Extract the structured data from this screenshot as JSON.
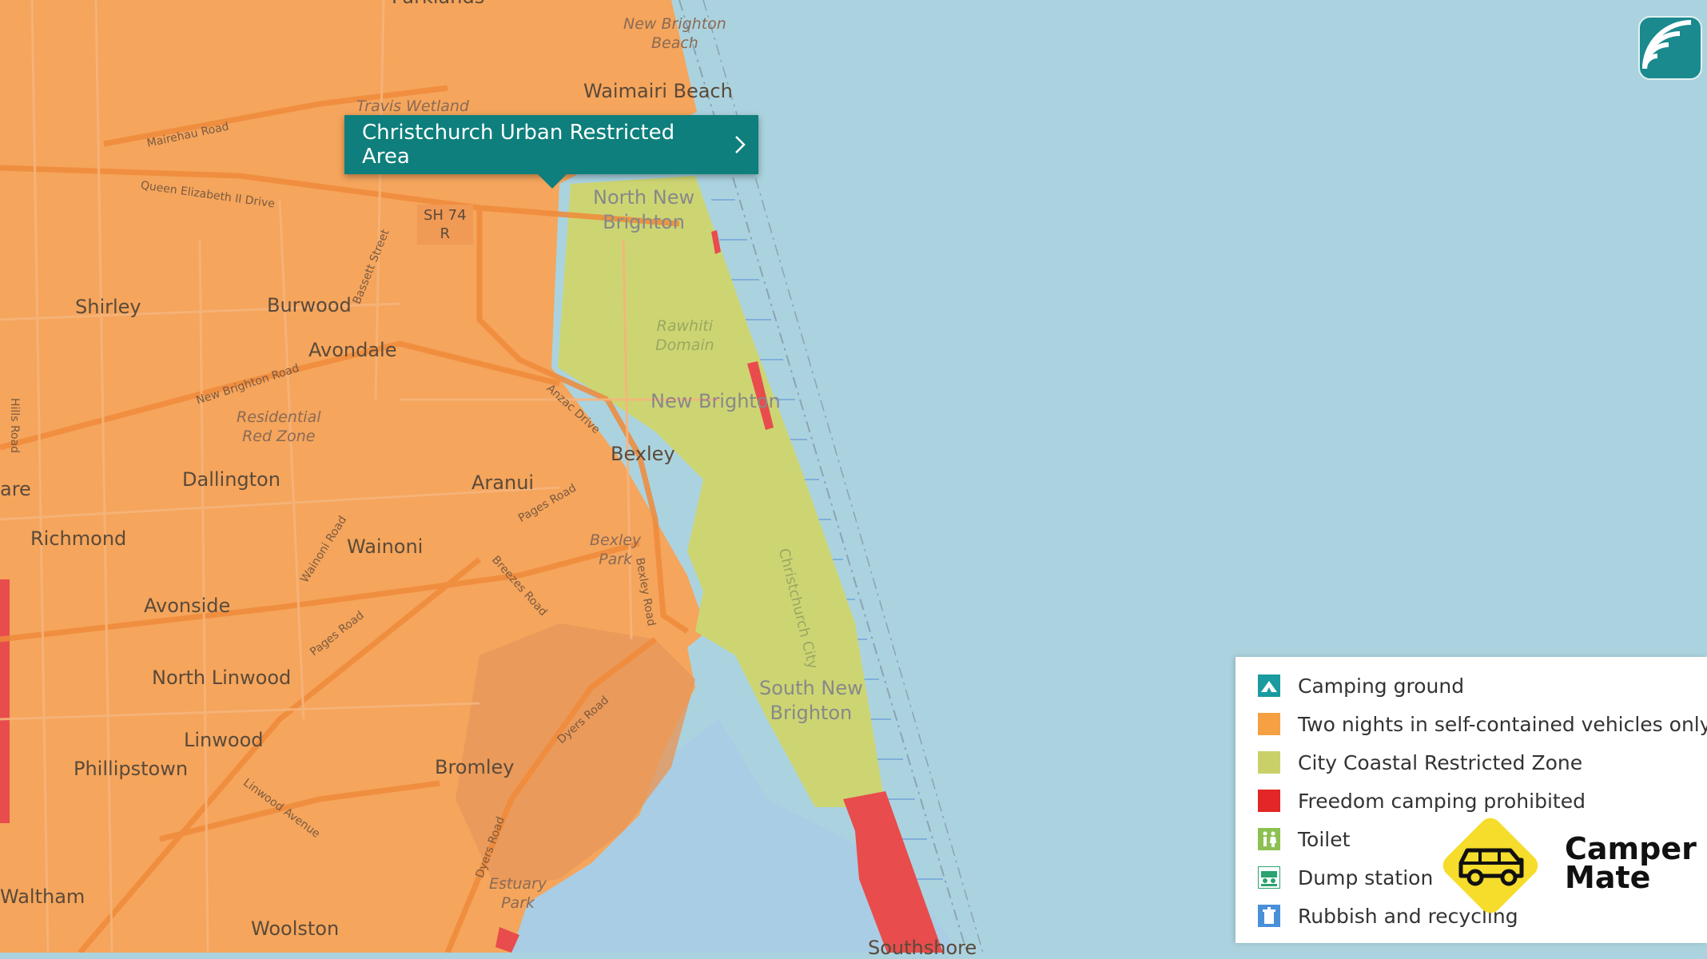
{
  "map": {
    "colors": {
      "water": "#abd3df",
      "two_nights_zone": "#f5a55c",
      "coastal_zone": "#cdd573",
      "prohibited": "#e84c4c",
      "tooltip_bg": "#0e7f7c"
    }
  },
  "places": {
    "parklands": "Parklands",
    "new_brighton_beach": "New Brighton\nBeach",
    "waimairi_beach": "Waimairi Beach",
    "travis_wetland": "Travis Wetland",
    "north_new_brighton": "North New\nBrighton",
    "sh74": "SH 74\nR",
    "shirley": "Shirley",
    "burwood": "Burwood",
    "avondale": "Avondale",
    "rawhiti_domain": "Rawhiti\nDomain",
    "new_brighton": "New Brighton",
    "residential_red_zone": "Residential\nRed Zone",
    "bexley": "Bexley",
    "dallington": "Dallington",
    "aranui": "Aranui",
    "richmond": "Richmond",
    "wainoni": "Wainoni",
    "bexley_park": "Bexley\nPark",
    "avonside": "Avonside",
    "north_linwood": "North Linwood",
    "south_new_brighton": "South New\nBrighton",
    "linwood": "Linwood",
    "phillipstown": "Phillipstown",
    "bromley": "Bromley",
    "estuary_park": "Estuary\nPark",
    "waltham": "Waltham",
    "woolston": "Woolston",
    "southshore": "Southshore",
    "are": "are"
  },
  "roads": {
    "mairehau_road": "Mairehau Road",
    "queen_elizabeth_drive": "Queen Elizabeth II Drive",
    "bassett_street": "Bassett Street",
    "hills_road": "Hills Road",
    "new_brighton_road": "New Brighton Road",
    "anzac_drive": "Anzac Drive",
    "pages_road_1": "Pages Road",
    "wainoni_road": "Wainoni Road",
    "breezes_road": "Breezes Road",
    "bexley_road": "Bexley Road",
    "pages_road_2": "Pages Road",
    "dyers_road_1": "Dyers Road",
    "linwood_avenue": "Linwood Avenue",
    "dyers_road_2": "Dyers Road",
    "christchurch_city": "Christchurch City"
  },
  "tooltip": {
    "label": "Christchurch Urban Restricted Area",
    "chevron_icon": "chevron-right-icon"
  },
  "legend": {
    "items": [
      {
        "label": "Camping ground",
        "icon": "camping-ground-icon",
        "color": "#1a9ba0"
      },
      {
        "label": "Two nights in self-contained vehicles only",
        "icon": "orange-swatch",
        "color": "#f5a043"
      },
      {
        "label": "City Coastal Restricted Zone",
        "icon": "yellow-green-swatch",
        "color": "#c9d06a"
      },
      {
        "label": "Freedom camping prohibited",
        "icon": "red-swatch",
        "color": "#e32626"
      },
      {
        "label": "Toilet",
        "icon": "toilet-icon",
        "color": "#8cc152"
      },
      {
        "label": "Dump station",
        "icon": "dump-station-icon",
        "color": "#2aa36f"
      },
      {
        "label": "Rubbish and recycling",
        "icon": "rubbish-bin-icon",
        "color": "#4a90d9"
      }
    ]
  },
  "brand": {
    "name": "Camper\nMate",
    "color": "#f6dc2b"
  }
}
